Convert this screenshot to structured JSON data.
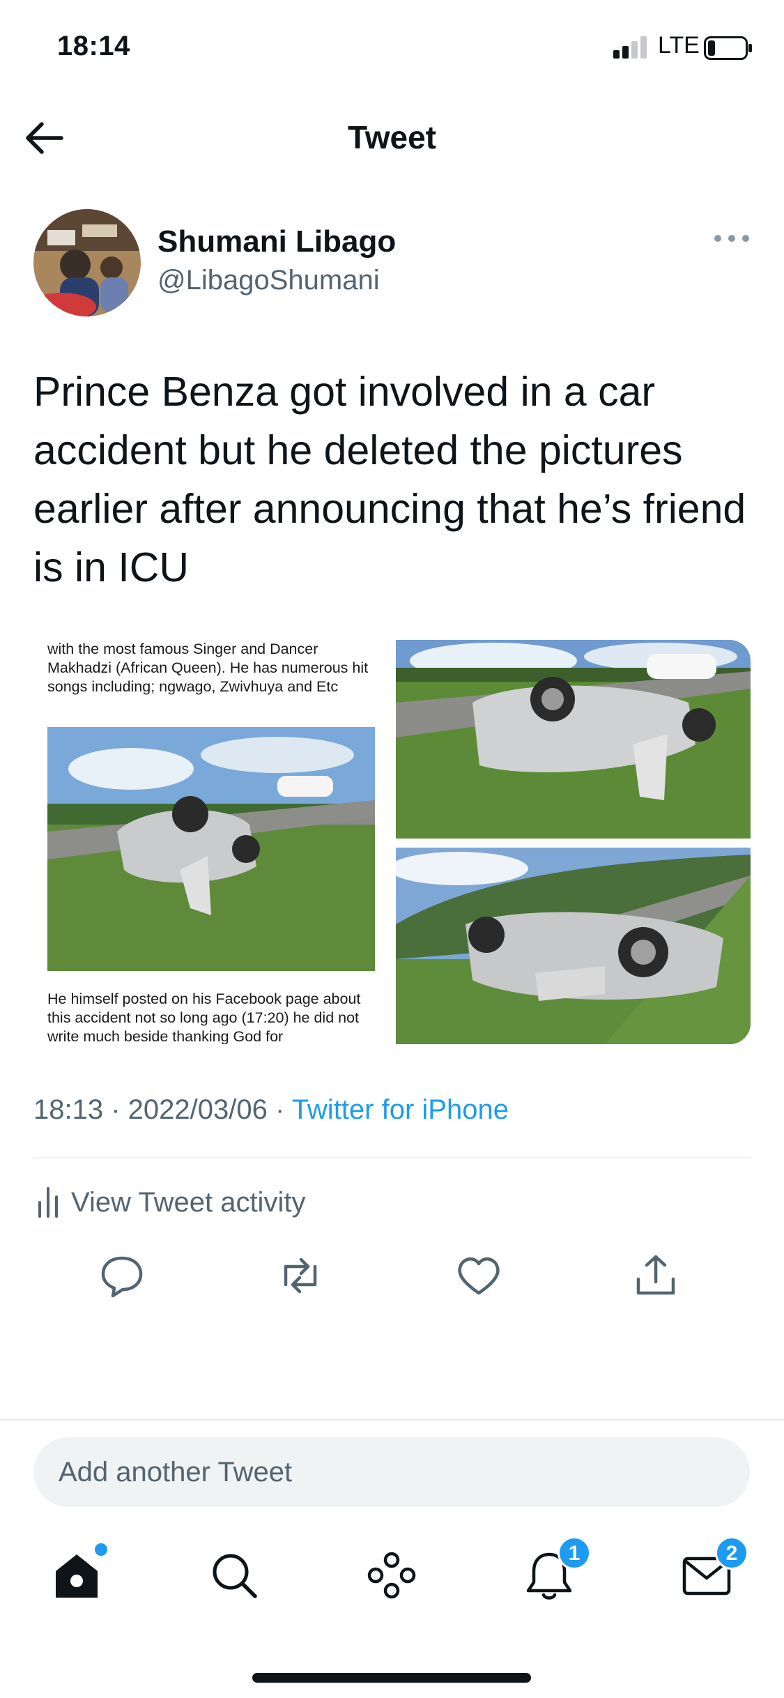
{
  "status_bar": {
    "time": "18:14",
    "network": "LTE"
  },
  "header": {
    "title": "Tweet"
  },
  "tweet": {
    "author_name": "Shumani Libago",
    "handle": "@LibagoShumani",
    "text": "Prince Benza got involved in a car accident but he deleted the pictures earlier after announcing that he’s friend is in ICU",
    "media": {
      "article_text_top": "with the most famous Singer and Dancer Makhadzi (African Queen). He has numerous hit songs including; ngwago, Zwivhuya and Etc",
      "article_text_bottom": "He himself posted on his Facebook page about this accident not so long ago (17:20) he did not write much beside thanking God for"
    },
    "time": "18:13",
    "date": "2022/03/06",
    "separator": " · ",
    "source": "Twitter for iPhone",
    "activity_label": "View Tweet activity"
  },
  "reply": {
    "placeholder": "Add another Tweet"
  },
  "tab_bar": {
    "notifications_badge": "1",
    "messages_badge": "2"
  },
  "colors": {
    "accent": "#1d9bf0",
    "text": "#0f1419",
    "muted": "#536471"
  },
  "icons": {
    "back": "arrow-left-icon",
    "more": "more-dots-icon",
    "activity": "bar-chart-icon",
    "reply": "reply-bubble-icon",
    "retweet": "retweet-icon",
    "like": "heart-icon",
    "share": "share-icon",
    "home": "home-icon",
    "search": "search-icon",
    "spaces": "spaces-icon",
    "notifications": "bell-icon",
    "messages": "envelope-icon"
  }
}
